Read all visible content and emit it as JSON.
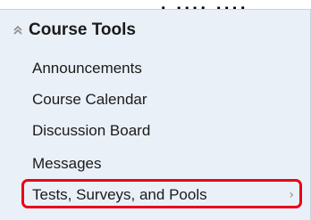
{
  "top_fragment": ", ..., ...,",
  "panel": {
    "title": "Course Tools",
    "collapse_icon": "double-chevron-up-icon",
    "items": [
      {
        "label": "Announcements"
      },
      {
        "label": "Course Calendar"
      },
      {
        "label": "Discussion Board"
      },
      {
        "label": "Messages"
      },
      {
        "label": "Tests, Surveys, and Pools",
        "arrow": "›",
        "highlighted": true
      }
    ]
  },
  "colors": {
    "panel_background": "#eaf0f8",
    "highlight_border": "#e8001c",
    "text": "#1a1a1a"
  }
}
